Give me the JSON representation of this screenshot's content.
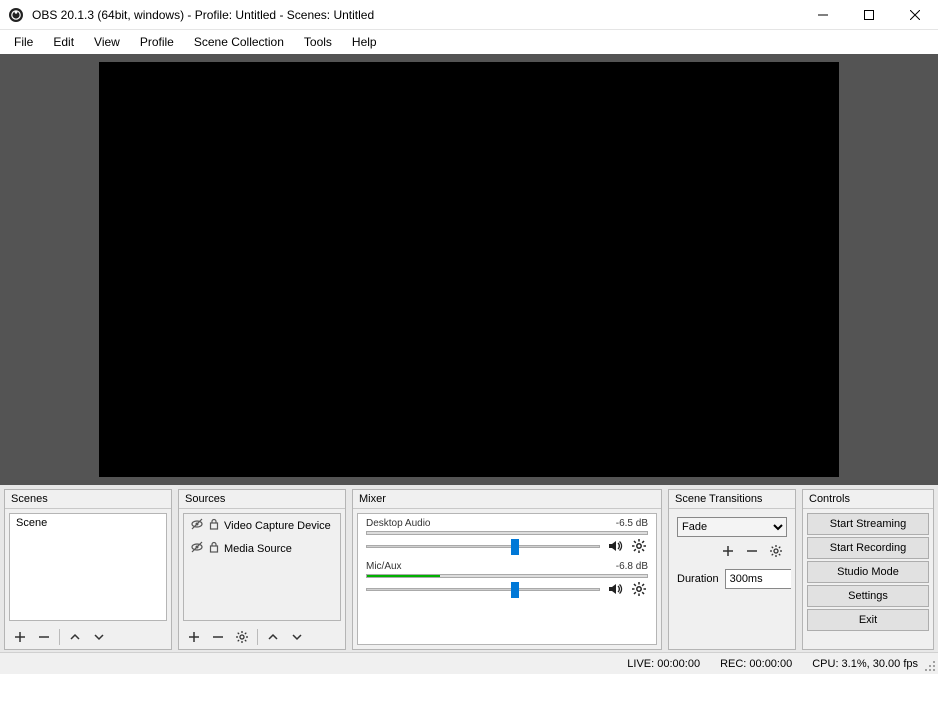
{
  "titlebar": {
    "title": "OBS 20.1.3 (64bit, windows) - Profile: Untitled - Scenes: Untitled"
  },
  "menubar": {
    "items": [
      "File",
      "Edit",
      "View",
      "Profile",
      "Scene Collection",
      "Tools",
      "Help"
    ]
  },
  "docks": {
    "scenes": {
      "header": "Scenes",
      "items": [
        "Scene"
      ]
    },
    "sources": {
      "header": "Sources",
      "items": [
        {
          "name": "Video Capture Device",
          "visible": false,
          "locked": true
        },
        {
          "name": "Media Source",
          "visible": false,
          "locked": true
        }
      ]
    },
    "mixer": {
      "header": "Mixer",
      "channels": [
        {
          "name": "Desktop Audio",
          "level_db": "-6.5 dB",
          "meter_pct": 0,
          "slider_pct": 62
        },
        {
          "name": "Mic/Aux",
          "level_db": "-6.8 dB",
          "meter_pct": 26,
          "slider_pct": 62
        }
      ]
    },
    "transitions": {
      "header": "Scene Transitions",
      "selected": "Fade",
      "duration_label": "Duration",
      "duration_value": "300ms"
    },
    "controls": {
      "header": "Controls",
      "buttons": [
        "Start Streaming",
        "Start Recording",
        "Studio Mode",
        "Settings",
        "Exit"
      ]
    }
  },
  "statusbar": {
    "live": "LIVE: 00:00:00",
    "rec": "REC: 00:00:00",
    "cpu": "CPU: 3.1%, 30.00 fps"
  }
}
